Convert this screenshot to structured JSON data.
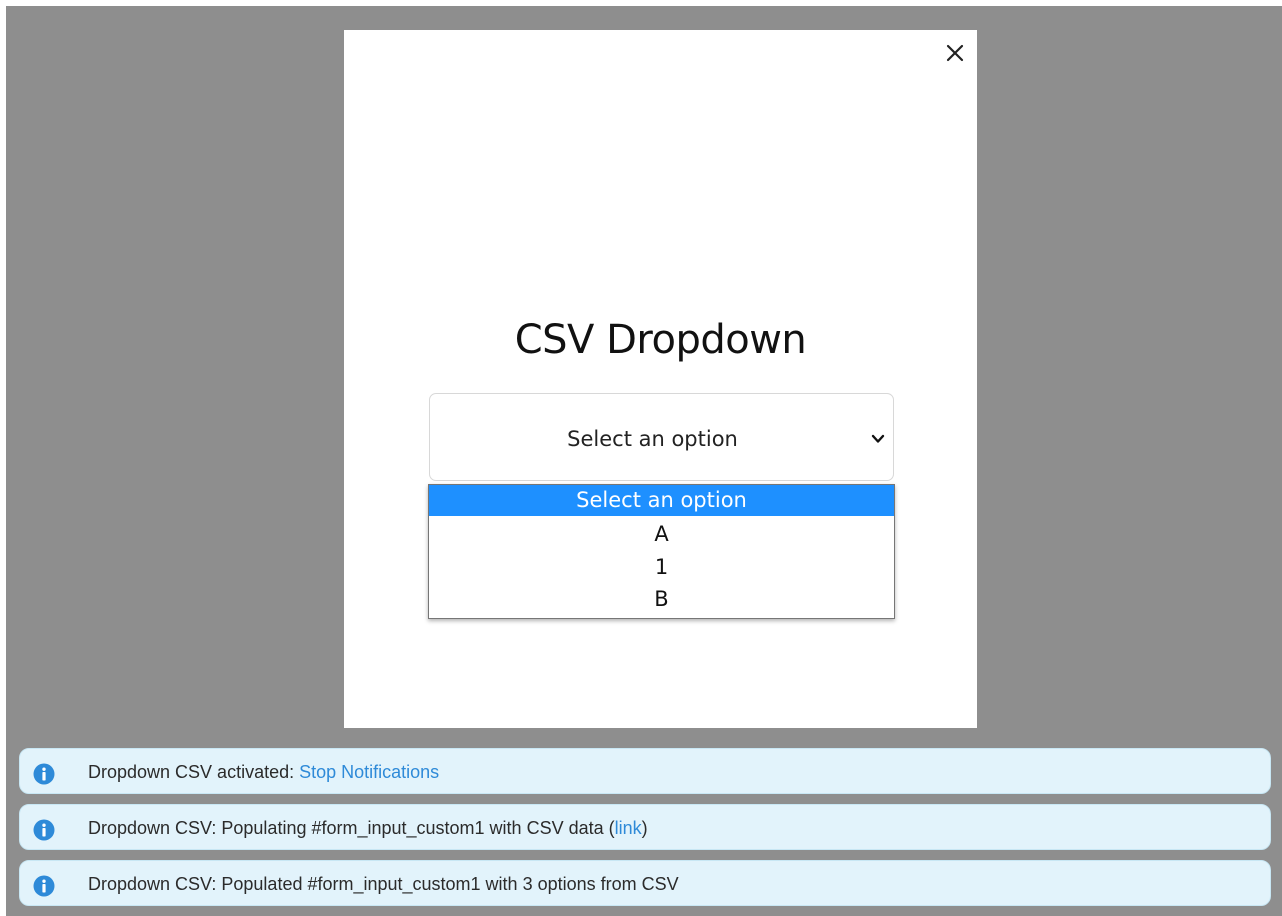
{
  "modal": {
    "title": "CSV Dropdown",
    "close_label": "×"
  },
  "dropdown": {
    "selected": "Select an option",
    "options": [
      "Select an option",
      "A",
      "1",
      "B"
    ]
  },
  "notifications": [
    {
      "text": "Dropdown CSV activated: ",
      "link": "Stop Notifications"
    },
    {
      "text": "Dropdown CSV: Populating #form_input_custom1 with CSV data (",
      "link": "link",
      "suffix": ")"
    },
    {
      "text": "Dropdown CSV: Populated #form_input_custom1 with 3 options from CSV"
    }
  ],
  "colors": {
    "overlay": "#8e8e8e",
    "highlight": "#1e90ff",
    "notice_bg": "#e2f3fb",
    "info_icon": "#2e8ad8",
    "link": "#2e8ad8"
  },
  "icons": {
    "close": "close-icon",
    "chevron": "chevron-down-icon",
    "info": "info-icon"
  }
}
